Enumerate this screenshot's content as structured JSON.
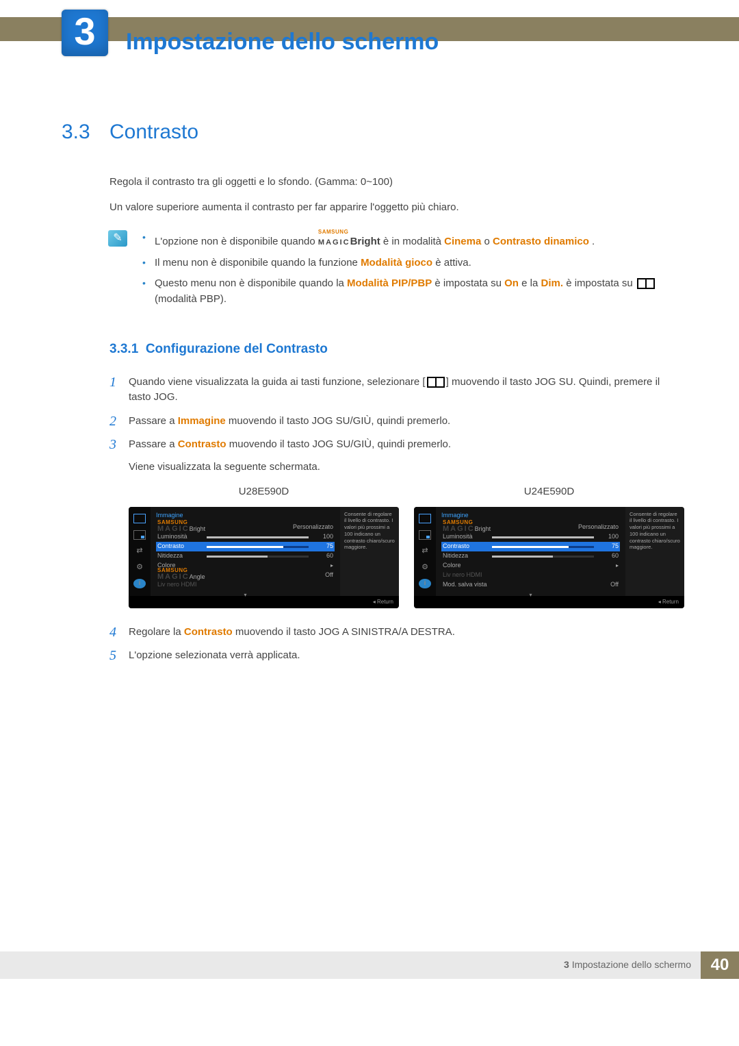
{
  "chapter": {
    "number": "3",
    "title": "Impostazione dello schermo"
  },
  "section": {
    "number": "3.3",
    "title": "Contrasto"
  },
  "paragraphs": {
    "p1": "Regola il contrasto tra gli oggetti e lo sfondo. (Gamma: 0~100)",
    "p2": "Un valore superiore aumenta il contrasto per far apparire l'oggetto più chiaro."
  },
  "notes": {
    "n1a": "L'opzione non è disponibile quando ",
    "n1_magic_sup": "SAMSUNG",
    "n1_magic_main": "MAGIC",
    "n1_bright": "Bright",
    "n1b": " è in modalità ",
    "n1_cinema": "Cinema",
    "n1c": " o ",
    "n1_dyn": "Contrasto dinamico",
    "n1d": ".",
    "n2a": "Il menu non è disponibile quando la funzione ",
    "n2_game": "Modalità gioco",
    "n2b": " è attiva.",
    "n3a": "Questo menu non è disponibile quando la ",
    "n3_pip": "Modalità PIP/PBP",
    "n3b": " è impostata su ",
    "n3_on": "On",
    "n3c": " e la ",
    "n3_dim": "Dim.",
    "n3d": " è impostata su ",
    "n3e": " (modalità PBP)."
  },
  "subsection": {
    "number": "3.3.1",
    "title": "Configurazione del Contrasto"
  },
  "steps": {
    "s1a": "Quando viene visualizzata la guida ai tasti funzione, selezionare [",
    "s1b": "] muovendo il tasto JOG SU. Quindi, premere il tasto JOG.",
    "s2a": "Passare a ",
    "s2_hl": "Immagine",
    "s2b": " muovendo il tasto JOG SU/GIÙ, quindi premerlo.",
    "s3a": "Passare a ",
    "s3_hl": "Contrasto",
    "s3b": " muovendo il tasto JOG SU/GIÙ, quindi premerlo.",
    "s3c": "Viene visualizzata la seguente schermata.",
    "s4a": "Regolare la ",
    "s4_hl": "Contrasto",
    "s4b": " muovendo il tasto JOG A SINISTRA/A DESTRA.",
    "s5": "L'opzione selezionata verrà applicata."
  },
  "osd_labels": {
    "left": "U28E590D",
    "right": "U24E590D"
  },
  "osd": {
    "head": "Immagine",
    "magic_sup": "SAMSUNG",
    "magic_main": "MAGIC",
    "bright": "Bright",
    "bright_val": "Personalizzato",
    "lum": "Luminosità",
    "lum_val": "100",
    "con": "Contrasto",
    "con_val": "75",
    "nit": "Nitidezza",
    "nit_val": "60",
    "col": "Colore",
    "angle": "Angle",
    "angle_val": "Off",
    "hdmi": "Liv nero HDMI",
    "mod_salva": "Mod. salva vista",
    "mod_salva_val": "Off",
    "help": "Consente di regolare il livello di contrasto. I valori più prossimi a 100 indicano un contrasto chiaro/scuro maggiore.",
    "return": "Return"
  },
  "footer": {
    "text_prefix": "3",
    "text": "Impostazione dello schermo",
    "page": "40"
  }
}
